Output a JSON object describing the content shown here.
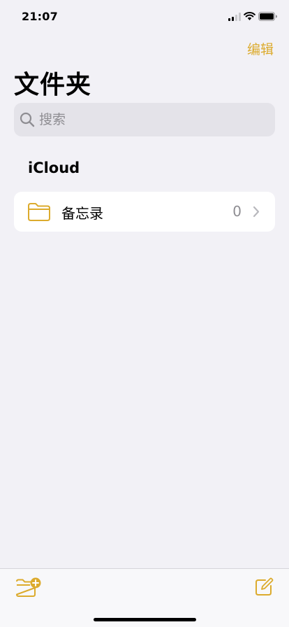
{
  "status_bar": {
    "time": "21:07",
    "icons": [
      "cellular-signal-icon",
      "wifi-icon",
      "battery-icon"
    ]
  },
  "header": {
    "edit_label": "编辑",
    "title": "文件夹"
  },
  "search": {
    "placeholder": "搜索",
    "value": "",
    "icon": "search-icon"
  },
  "section": {
    "title": "iCloud"
  },
  "folders": [
    {
      "name": "备忘录",
      "count": "0",
      "icon": "folder-icon"
    }
  ],
  "toolbar": {
    "left_icon": "new-folder-icon",
    "right_icon": "compose-icon"
  },
  "colors": {
    "accent": "#dcab2d",
    "background": "#f2f1f6",
    "card": "#ffffff",
    "search_field": "#e4e3e9",
    "secondary_text": "#8e8d92"
  }
}
